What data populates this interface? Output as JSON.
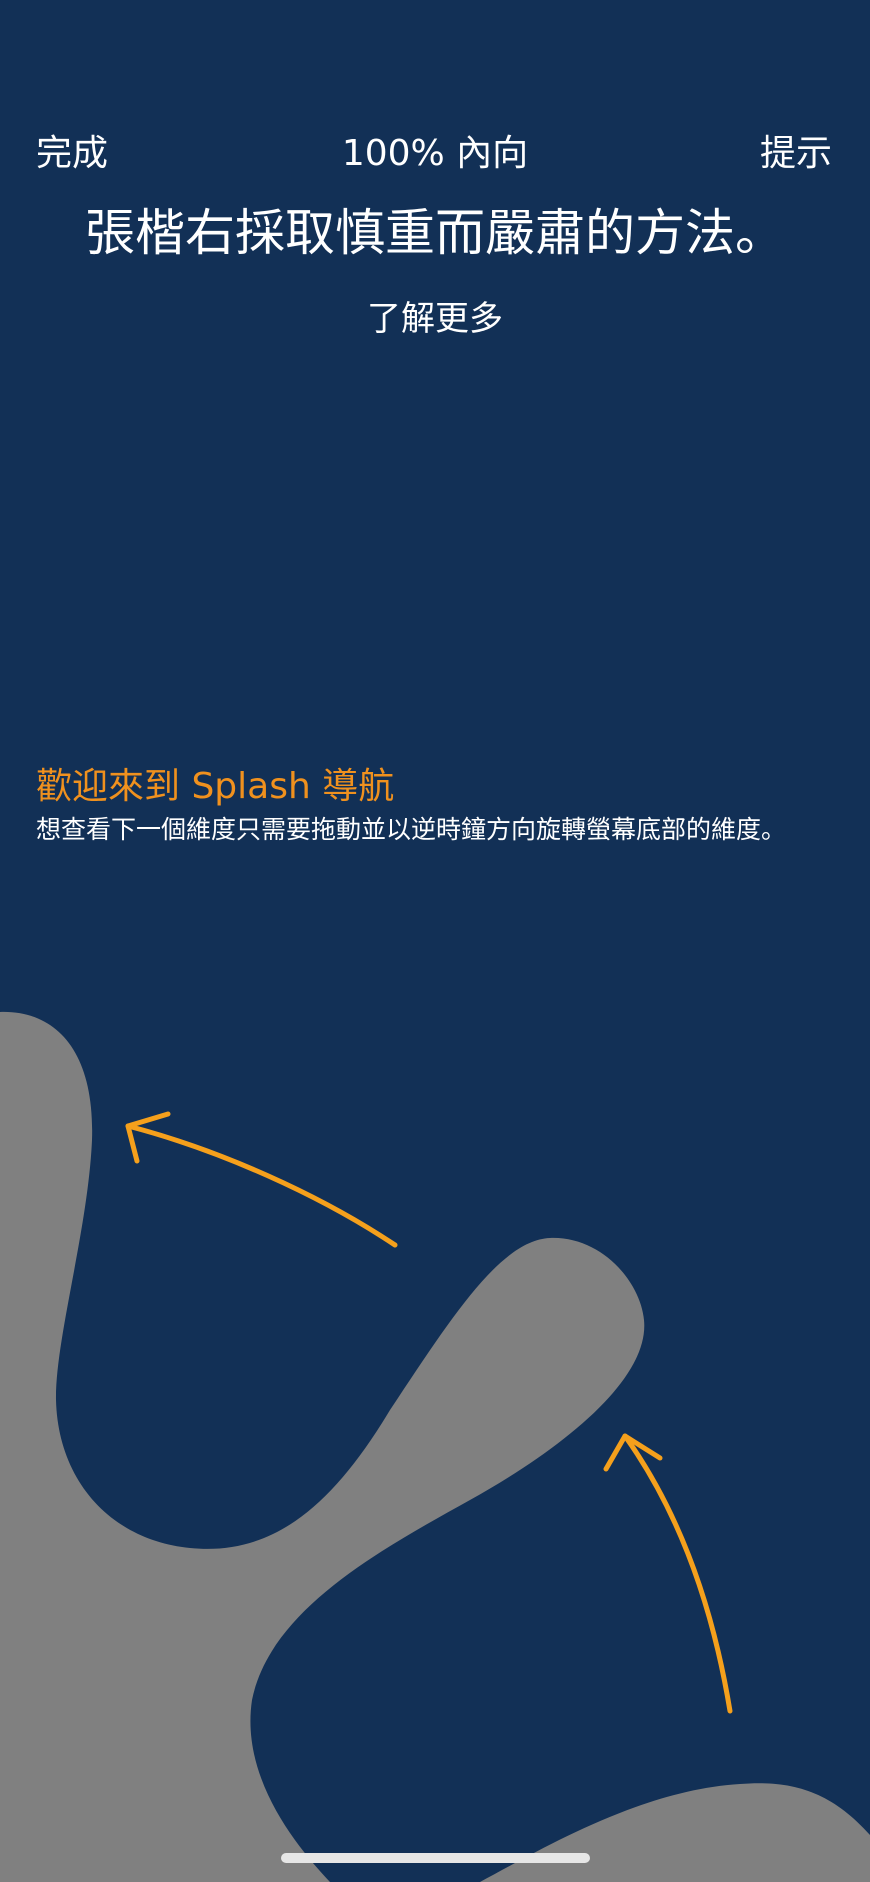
{
  "top_bar": {
    "done_label": "完成",
    "mode_label": "100% 內向",
    "hint_label": "提示"
  },
  "headline": "張楷右採取慎重而嚴肅的方法。",
  "learn_more_label": "了解更多",
  "onboarding": {
    "title": "歡迎來到 Splash 導航",
    "body": "想查看下一個維度只需要拖動並以逆時鐘方向旋轉螢幕底部的維度。"
  },
  "colors": {
    "background": "#123056",
    "blob": "#808080",
    "accent": "#f0911e",
    "arrow": "#f5a01c",
    "text": "#ffffff"
  },
  "icons": {
    "arrow_upper": "curved-arrow-icon",
    "arrow_lower": "curved-arrow-icon"
  }
}
